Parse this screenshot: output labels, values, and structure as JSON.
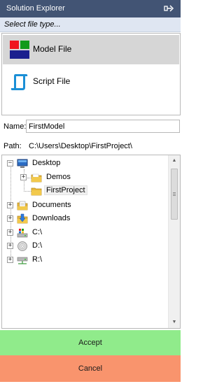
{
  "window": {
    "title": "Solution Explorer"
  },
  "colors": {
    "titlebar": "#425474",
    "accept": "#90eb8b",
    "cancel": "#f9946d"
  },
  "file_type": {
    "prompt": "Select file type...",
    "items": [
      {
        "label": "Model File",
        "icon": "model-file-icon",
        "selected": true
      },
      {
        "label": "Script File",
        "icon": "script-file-icon",
        "selected": false
      }
    ]
  },
  "name": {
    "label": "Name:",
    "value": "FirstModel"
  },
  "path": {
    "label": "Path:",
    "value": "C:\\Users\\Desktop\\FirstProject\\"
  },
  "tree": {
    "nodes": [
      {
        "label": "Desktop",
        "icon": "desktop-icon",
        "expanded": true
      },
      {
        "label": "Demos",
        "icon": "folder-icon",
        "expanded": false
      },
      {
        "label": "FirstProject",
        "icon": "folder-icon",
        "selected": true
      },
      {
        "label": "Documents",
        "icon": "documents-icon",
        "expanded": false
      },
      {
        "label": "Downloads",
        "icon": "downloads-icon",
        "expanded": false
      },
      {
        "label": "C:\\",
        "icon": "system-drive-icon",
        "expanded": false
      },
      {
        "label": "D:\\",
        "icon": "disc-drive-icon",
        "expanded": false
      },
      {
        "label": "R:\\",
        "icon": "network-drive-icon",
        "expanded": false
      }
    ]
  },
  "buttons": {
    "accept": "Accept",
    "cancel": "Cancel"
  }
}
